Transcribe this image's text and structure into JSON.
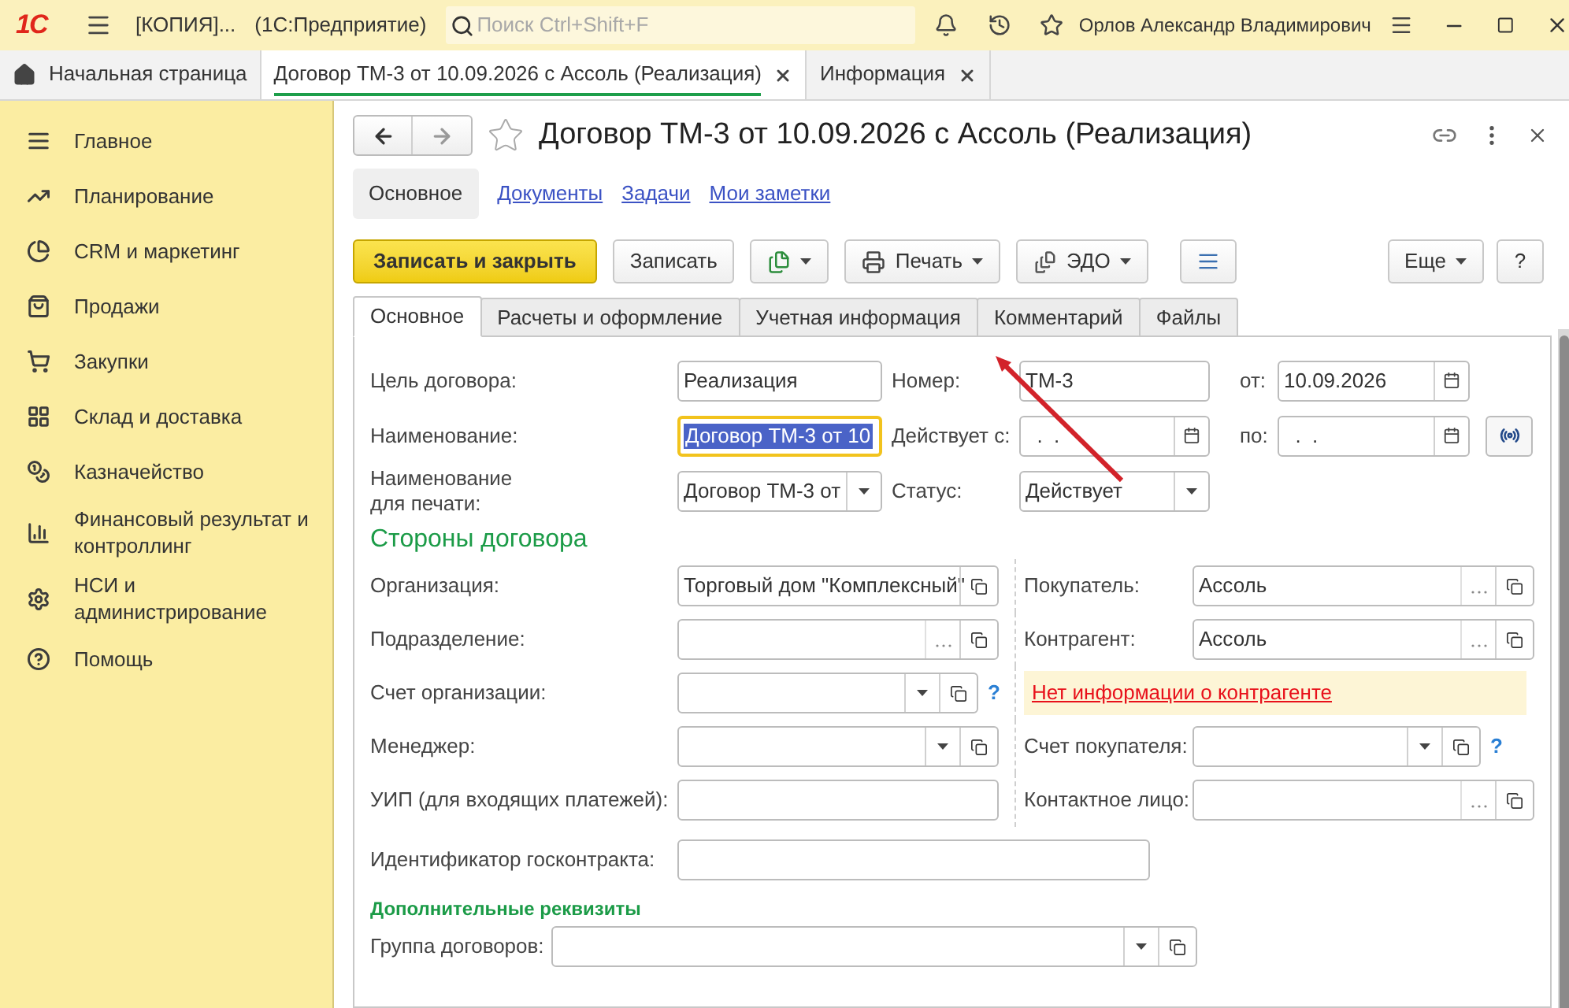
{
  "title_bar": {
    "logo": "1С",
    "app_title": "[КОПИЯ]...",
    "app_name": "(1С:Предприятие)",
    "search": {
      "placeholder": "Поиск Ctrl+Shift+F"
    },
    "user": "Орлов Александр Владимирович"
  },
  "open_tabs": [
    {
      "kind": "home",
      "label": "Начальная страница",
      "selected": false
    },
    {
      "kind": "document",
      "label": "Договор ТМ-3 от 10.09.2026 с Ассоль (Реализация)",
      "selected": true
    },
    {
      "kind": "document",
      "label": "Информация",
      "selected": false
    }
  ],
  "sidebar": {
    "items": [
      {
        "label": "Главное"
      },
      {
        "label": "Планирование"
      },
      {
        "label": "CRM и маркетинг"
      },
      {
        "label": "Продажи"
      },
      {
        "label": "Закупки"
      },
      {
        "label": "Склад и доставка"
      },
      {
        "label": "Казначейство"
      },
      {
        "label": "Финансовый результат и контроллинг"
      },
      {
        "label": "НСИ и администрирование"
      },
      {
        "label": "Помощь"
      }
    ]
  },
  "form": {
    "title": "Договор ТМ-3 от 10.09.2026 с Ассоль (Реализация)",
    "favorite": false,
    "nav": [
      {
        "label": "Основное",
        "selected": true
      },
      {
        "label": "Документы",
        "selected": false
      },
      {
        "label": "Задачи",
        "selected": false
      },
      {
        "label": "Мои заметки",
        "selected": false
      }
    ],
    "toolbar": [
      {
        "kind": "primary",
        "label": "Записать и закрыть"
      },
      {
        "kind": "plain",
        "label": "Записать"
      },
      {
        "kind": "create-menu"
      },
      {
        "kind": "print-menu",
        "label": "Печать"
      },
      {
        "kind": "edo-menu",
        "label": "ЭДО"
      },
      {
        "kind": "list"
      }
    ],
    "toolbar_right": [
      {
        "kind": "menu",
        "label": "Еще"
      },
      {
        "kind": "plain",
        "label": "?"
      }
    ],
    "tabs": [
      {
        "label": "Основное",
        "selected": true
      },
      {
        "label": "Расчеты и оформление",
        "selected": false
      },
      {
        "label": "Учетная информация",
        "selected": false
      },
      {
        "label": "Комментарий",
        "selected": false
      },
      {
        "label": "Файлы",
        "selected": false
      }
    ],
    "header_rows": [
      {
        "cells": [
          {
            "label": "Цель договора:",
            "field": {
              "kind": "input",
              "value": "Реализация",
              "focused": false
            }
          },
          {
            "label": "Номер:",
            "field": {
              "kind": "input",
              "value": "ТМ-3",
              "focused": false
            }
          },
          {
            "label": "от:",
            "field": {
              "kind": "date",
              "value": "10.09.2026",
              "focused": false
            }
          }
        ]
      },
      {
        "cells": [
          {
            "label": "Наименование:",
            "field": {
              "kind": "input",
              "value": "Договор ТМ-3 от 10",
              "focused": true
            }
          },
          {
            "label": "Действует с:",
            "field": {
              "kind": "date",
              "value": "  .  .",
              "focused": false
            }
          },
          {
            "label": "по:",
            "field": {
              "kind": "date-period",
              "value": "  .  .",
              "focused": false
            }
          }
        ]
      },
      {
        "cells": [
          {
            "label": "Наименование для печати:",
            "field": {
              "kind": "dropdown",
              "value": "Договор ТМ-3 от",
              "focused": false
            }
          },
          {
            "label": "Статус:",
            "field": {
              "kind": "dropdown",
              "value": "Действует",
              "focused": false
            }
          }
        ]
      }
    ],
    "parties": {
      "title": "Стороны договора",
      "rows": [
        {
          "left": {
            "label": "Организация:",
            "field": {
              "kind": "open",
              "value": "Торговый дом \"Комплексный\"",
              "focused": false
            }
          },
          "right": {
            "kind": "field",
            "label": "Покупатель:",
            "field": {
              "kind": "choose-open",
              "value": "Ассоль",
              "focused": false
            }
          }
        },
        {
          "left": {
            "label": "Подразделение:",
            "field": {
              "kind": "choose-open",
              "focused": false
            }
          },
          "right": {
            "kind": "field",
            "label": "Контрагент:",
            "field": {
              "kind": "choose-open",
              "value": "Ассоль",
              "focused": false
            }
          }
        },
        {
          "left": {
            "label": "Счет организации:",
            "field": {
              "kind": "dropdown-open",
              "focused": false
            },
            "help": "?"
          },
          "right": {
            "kind": "warning",
            "text": "Нет информации о контрагенте"
          }
        },
        {
          "left": {
            "label": "Менеджер:",
            "field": {
              "kind": "dropdown-open",
              "focused": false
            }
          },
          "right": {
            "kind": "field",
            "label": "Счет покупателя:",
            "field": {
              "kind": "dropdown-open",
              "focused": false
            },
            "help": "?"
          }
        },
        {
          "left": {
            "label": "УИП (для входящих платежей):",
            "field": {
              "kind": "input",
              "focused": false
            }
          },
          "right": {
            "kind": "field",
            "label": "Контактное лицо:",
            "field": {
              "kind": "choose-open",
              "focused": false
            }
          }
        }
      ],
      "contract_id": {
        "label": "Идентификатор госконтракта:",
        "field": {
          "kind": "input",
          "focused": false
        }
      }
    },
    "extra": {
      "title": "Дополнительные реквизиты",
      "label": "Группа договоров:",
      "field": {
        "kind": "dropdown-open",
        "focused": false
      }
    }
  }
}
